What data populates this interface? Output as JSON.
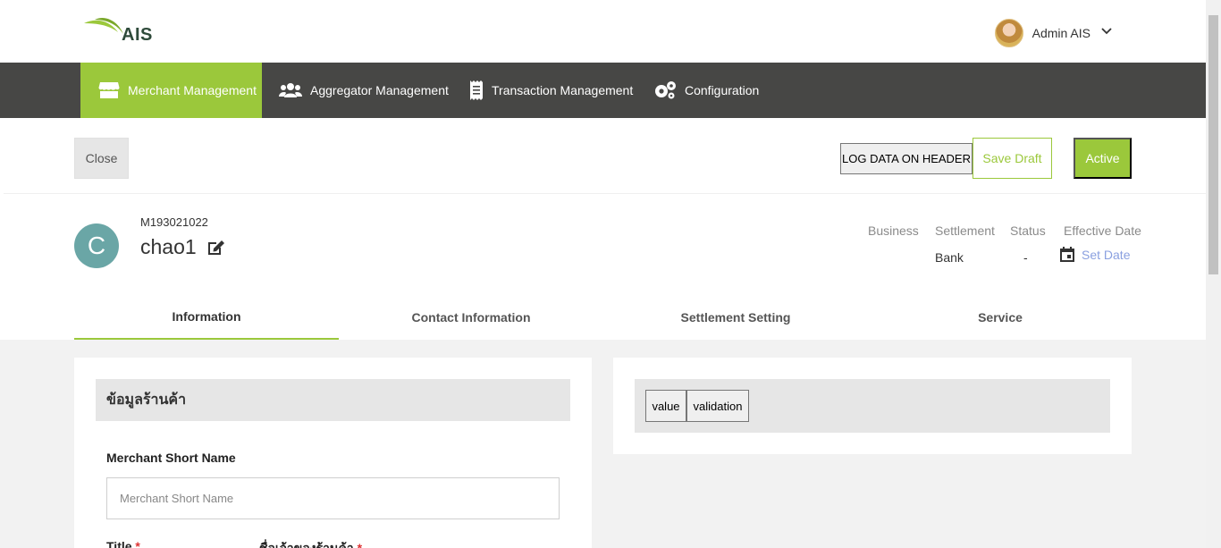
{
  "brand": {
    "name": "AIS",
    "accent": "#9bc83b",
    "nav_bg": "#474745"
  },
  "user": {
    "name": "Admin AIS",
    "chevron": "chevron-down-icon"
  },
  "nav": {
    "items": [
      {
        "label": "Merchant Management",
        "icon": "store-icon",
        "active": true
      },
      {
        "label": "Aggregator Management",
        "icon": "users-icon",
        "active": false
      },
      {
        "label": "Transaction Management",
        "icon": "receipt-icon",
        "active": false
      },
      {
        "label": "Configuration",
        "icon": "gears-icon",
        "active": false
      }
    ]
  },
  "actions": {
    "close": "Close",
    "log": "LOG DATA ON HEADER",
    "save_draft": "Save Draft",
    "active": "Active"
  },
  "merchant": {
    "initial": "C",
    "id": "M193021022",
    "name": "chao1"
  },
  "stats": {
    "business_label": "Business",
    "settlement_label": "Settlement",
    "settlement_value": "Bank",
    "status_label": "Status",
    "status_value": "-",
    "effective_label": "Effective Date",
    "set_date": "Set Date"
  },
  "tabs": [
    {
      "label": "Information",
      "active": true
    },
    {
      "label": "Contact Information",
      "active": false
    },
    {
      "label": "Settlement Setting",
      "active": false
    },
    {
      "label": "Service",
      "active": false
    }
  ],
  "form": {
    "section_title": "ข้อมูลร้านค้า",
    "short_name_label": "Merchant Short Name",
    "short_name_placeholder": "Merchant Short Name",
    "short_name_value": "",
    "title_label": "Title",
    "shop_owner_label": "ชื่อเจ้าของร้านค้า",
    "required_mark": "*"
  },
  "debug": {
    "value_btn": "value",
    "validation_btn": "validation"
  }
}
